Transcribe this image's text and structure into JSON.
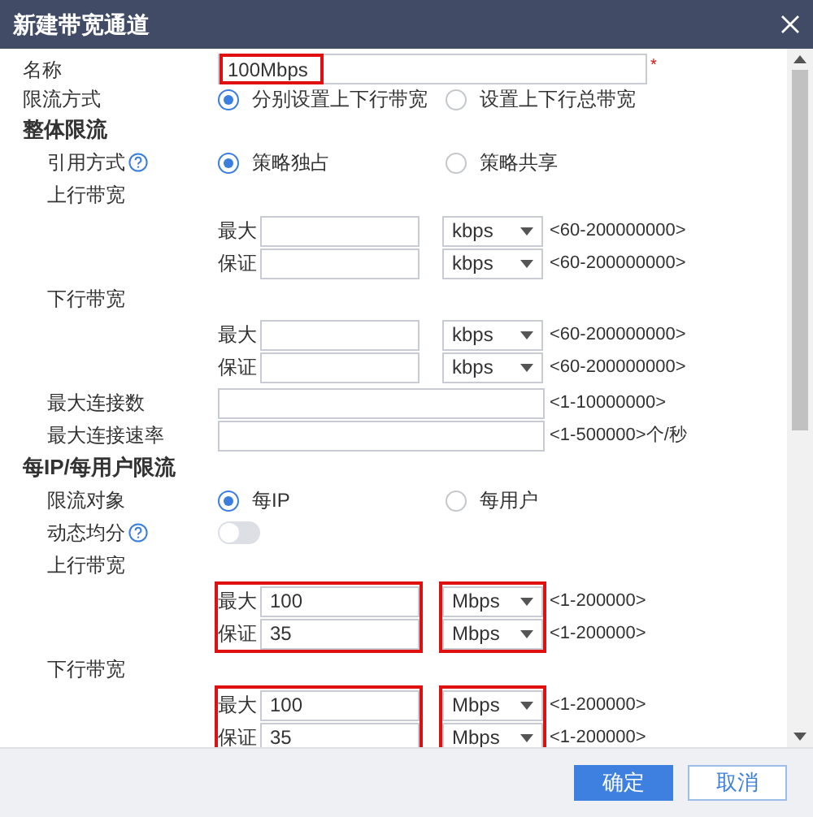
{
  "title": "新建带宽通道",
  "form": [
    {
      "kind": "field",
      "label": "名称",
      "value": "100Mbps",
      "required_mark": "*",
      "highlighted": true
    },
    {
      "kind": "radio",
      "label": "限流方式",
      "options": [
        {
          "label": "分别设置上下行带宽",
          "selected": true
        },
        {
          "label": "设置上下行总带宽",
          "selected": false
        }
      ]
    },
    {
      "kind": "section",
      "label": "整体限流",
      "children": [
        {
          "kind": "radio",
          "label": "引用方式",
          "help": true,
          "options": [
            {
              "label": "策略独占",
              "selected": true
            },
            {
              "label": "策略共享",
              "selected": false
            }
          ]
        },
        {
          "kind": "bandwidth",
          "label": "上行带宽",
          "highlighted": false,
          "rows": [
            {
              "label": "最大",
              "unit": "kbps",
              "range": "<60-200000000>"
            },
            {
              "label": "保证",
              "unit": "kbps",
              "range": "<60-200000000>"
            }
          ]
        },
        {
          "kind": "bandwidth",
          "label": "下行带宽",
          "highlighted": false,
          "rows": [
            {
              "label": "最大",
              "unit": "kbps",
              "range": "<60-200000000>"
            },
            {
              "label": "保证",
              "unit": "kbps",
              "range": "<60-200000000>"
            }
          ]
        },
        {
          "kind": "field",
          "label": "最大连接数",
          "range": "<1-10000000>"
        },
        {
          "kind": "field",
          "label": "最大连接速率",
          "range": "<1-500000>个/秒"
        }
      ]
    },
    {
      "kind": "section",
      "label": "每IP/每用户限流",
      "children": [
        {
          "kind": "radio",
          "label": "限流对象",
          "options": [
            {
              "label": "每IP",
              "selected": true
            },
            {
              "label": "每用户",
              "selected": false
            }
          ]
        },
        {
          "kind": "toggle",
          "label": "动态均分",
          "help": true,
          "on": false
        },
        {
          "kind": "bandwidth",
          "label": "上行带宽",
          "highlighted": true,
          "rows": [
            {
              "label": "最大",
              "value": "100",
              "unit": "Mbps",
              "range": "<1-200000>"
            },
            {
              "label": "保证",
              "value": "35",
              "unit": "Mbps",
              "range": "<1-200000>"
            }
          ]
        },
        {
          "kind": "bandwidth",
          "label": "下行带宽",
          "highlighted": true,
          "rows": [
            {
              "label": "最大",
              "value": "100",
              "unit": "Mbps",
              "range": "<1-200000>"
            },
            {
              "label": "保证",
              "value": "35",
              "unit": "Mbps",
              "range": "<1-200000>"
            }
          ]
        }
      ]
    }
  ],
  "buttons": [
    {
      "label": "确定",
      "primary": true
    },
    {
      "label": "取消",
      "primary": false
    }
  ]
}
